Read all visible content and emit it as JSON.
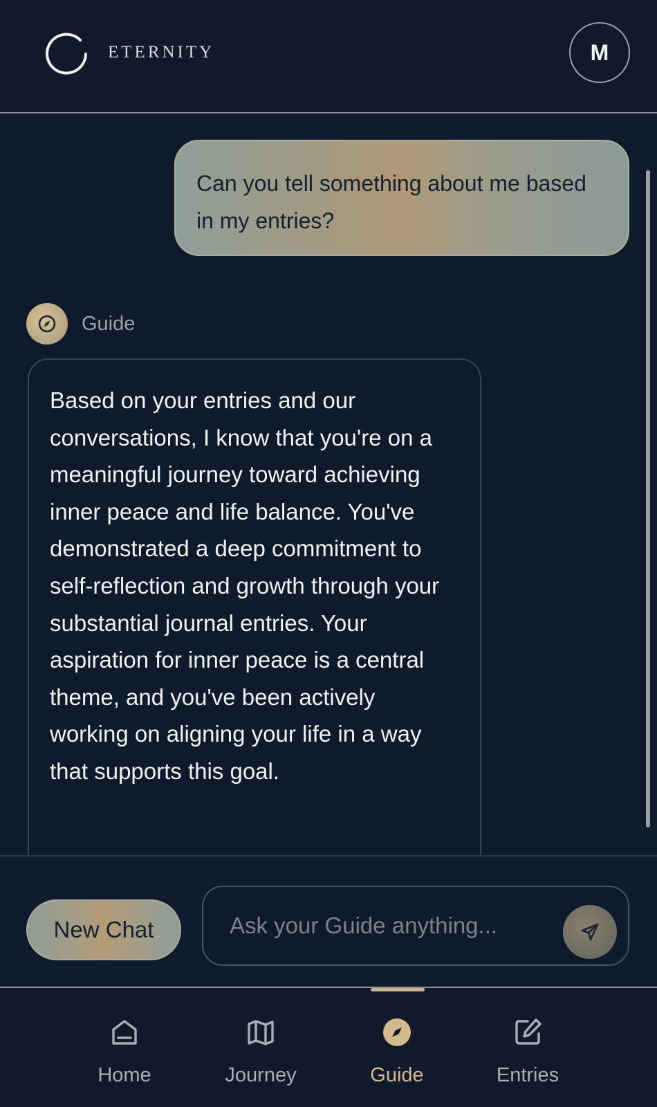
{
  "app": {
    "brand": "ETERNITY",
    "avatar_initial": "M"
  },
  "chat": {
    "user_message": "Can you tell something about me based in my entries?",
    "guide_name": "Guide",
    "guide_message": "Based on your entries and our conversations, I know that you're on a meaningful journey toward achieving inner peace and life balance. You've demonstrated a deep commitment to self-reflection and growth through your substantial journal entries. Your aspiration for inner peace is a central theme, and you've been actively working on aligning your life in a way that supports this goal."
  },
  "composer": {
    "new_chat_label": "New Chat",
    "placeholder": "Ask your Guide anything..."
  },
  "nav": {
    "items": [
      {
        "label": "Home",
        "icon": "home-icon"
      },
      {
        "label": "Journey",
        "icon": "map-icon"
      },
      {
        "label": "Guide",
        "icon": "compass-icon",
        "active": true
      },
      {
        "label": "Entries",
        "icon": "edit-icon"
      }
    ]
  },
  "colors": {
    "background": "#0f1a2b",
    "accent": "#d4b98e",
    "inactive": "#a8aeb5"
  }
}
